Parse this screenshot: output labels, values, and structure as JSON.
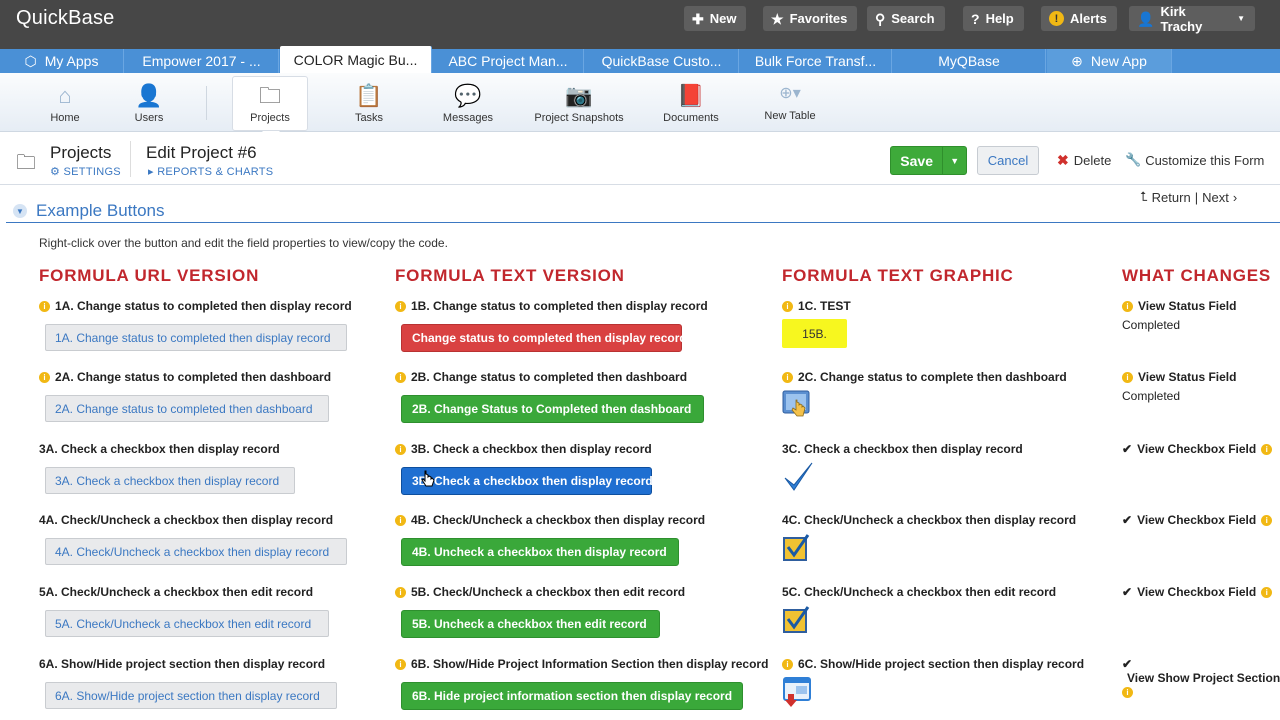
{
  "brand": "QuickBase",
  "top_buttons": {
    "new": "New",
    "favorites": "Favorites",
    "search": "Search",
    "help": "Help",
    "alerts": "Alerts",
    "user": "Kirk Trachy"
  },
  "app_tabs": [
    "My Apps",
    "Empower 2017 - ...",
    "COLOR Magic Bu...",
    "ABC Project Man...",
    "QuickBase Custo...",
    "Bulk Force Transf...",
    "MyQBase",
    "New App"
  ],
  "toolbar": [
    "Home",
    "Users",
    "Projects",
    "Tasks",
    "Messages",
    "Project Snapshots",
    "Documents",
    "New Table"
  ],
  "header": {
    "table_name": "Projects",
    "settings": "SETTINGS",
    "edit_title": "Edit Project #6",
    "reports": "REPORTS & CHARTS",
    "save": "Save",
    "cancel": "Cancel",
    "delete": "Delete",
    "customize": "Customize this Form"
  },
  "section": {
    "title": "Example Buttons",
    "return": "Return",
    "next": "Next",
    "intro": "Right-click over the button and edit the field properties to view/copy the code."
  },
  "columns": {
    "url": "FORMULA URL VERSION",
    "text": "FORMULA TEXT VERSION",
    "graphic": "FORMULA TEXT GRAPHIC",
    "changes": "WHAT CHANGES"
  },
  "url_col": [
    {
      "label": "1A. Change status to completed then display record",
      "button": "1A. Change status to completed then display record"
    },
    {
      "label": "2A. Change status to completed then dashboard",
      "button": "2A. Change status to completed then dashboard"
    },
    {
      "label": "3A. Check a checkbox then display record",
      "button": "3A. Check a checkbox then display record"
    },
    {
      "label": "4A. Check/Uncheck a checkbox then display record",
      "button": "4A. Check/Uncheck a checkbox then display record"
    },
    {
      "label": "5A. Check/Uncheck a checkbox then edit record",
      "button": "5A. Check/Uncheck a checkbox then edit record"
    },
    {
      "label": "6A. Show/Hide project section then display record",
      "button": "6A. Show/Hide project section then display record"
    }
  ],
  "text_col": [
    {
      "label": "1B. Change status to completed then display record",
      "button": "Change status to completed then display record",
      "color": "#d94141"
    },
    {
      "label": "2B. Change status to completed then dashboard",
      "button": "2B. Change Status to Completed then dashboard",
      "color": "#3aa83a"
    },
    {
      "label": "3B. Check a checkbox then display record",
      "button": "3B. Check a checkbox then display record",
      "color": "#1f6fd1"
    },
    {
      "label": "4B. Check/Uncheck a checkbox then display record",
      "button": "4B. Uncheck a checkbox then display record",
      "color": "#3aa83a"
    },
    {
      "label": "5B. Check/Uncheck a checkbox then edit record",
      "button": "5B. Uncheck a checkbox then edit record",
      "color": "#3aa83a"
    },
    {
      "label": "6B. Show/Hide Project Information Section then display record",
      "button": "6B. Hide project information section then display record",
      "color": "#3aa83a"
    }
  ],
  "graphic_col": [
    {
      "label": "1C. TEST",
      "tag": "15B."
    },
    {
      "label": "2C. Change status to complete then dashboard",
      "icon": "hand-pointer-icon"
    },
    {
      "label": "3C. Check a checkbox then display record",
      "icon": "checkmark-icon"
    },
    {
      "label": "4C. Check/Uncheck a checkbox then display record",
      "icon": "checked-box-icon"
    },
    {
      "label": "5C. Check/Uncheck a checkbox then edit record",
      "icon": "checked-box-icon"
    },
    {
      "label": "6C. Show/Hide project section then display record",
      "icon": "window-down-arrow-icon"
    }
  ],
  "changes_col": [
    {
      "label": "View Status Field",
      "value": "Completed"
    },
    {
      "label": "View Status Field",
      "value": "Completed"
    },
    {
      "label": "View Checkbox Field",
      "value": "✔"
    },
    {
      "label": "View Checkbox Field",
      "value": "✔"
    },
    {
      "label": "View Checkbox Field",
      "value": "✔"
    },
    {
      "label": "View Show Project Section",
      "value": "✔"
    }
  ]
}
